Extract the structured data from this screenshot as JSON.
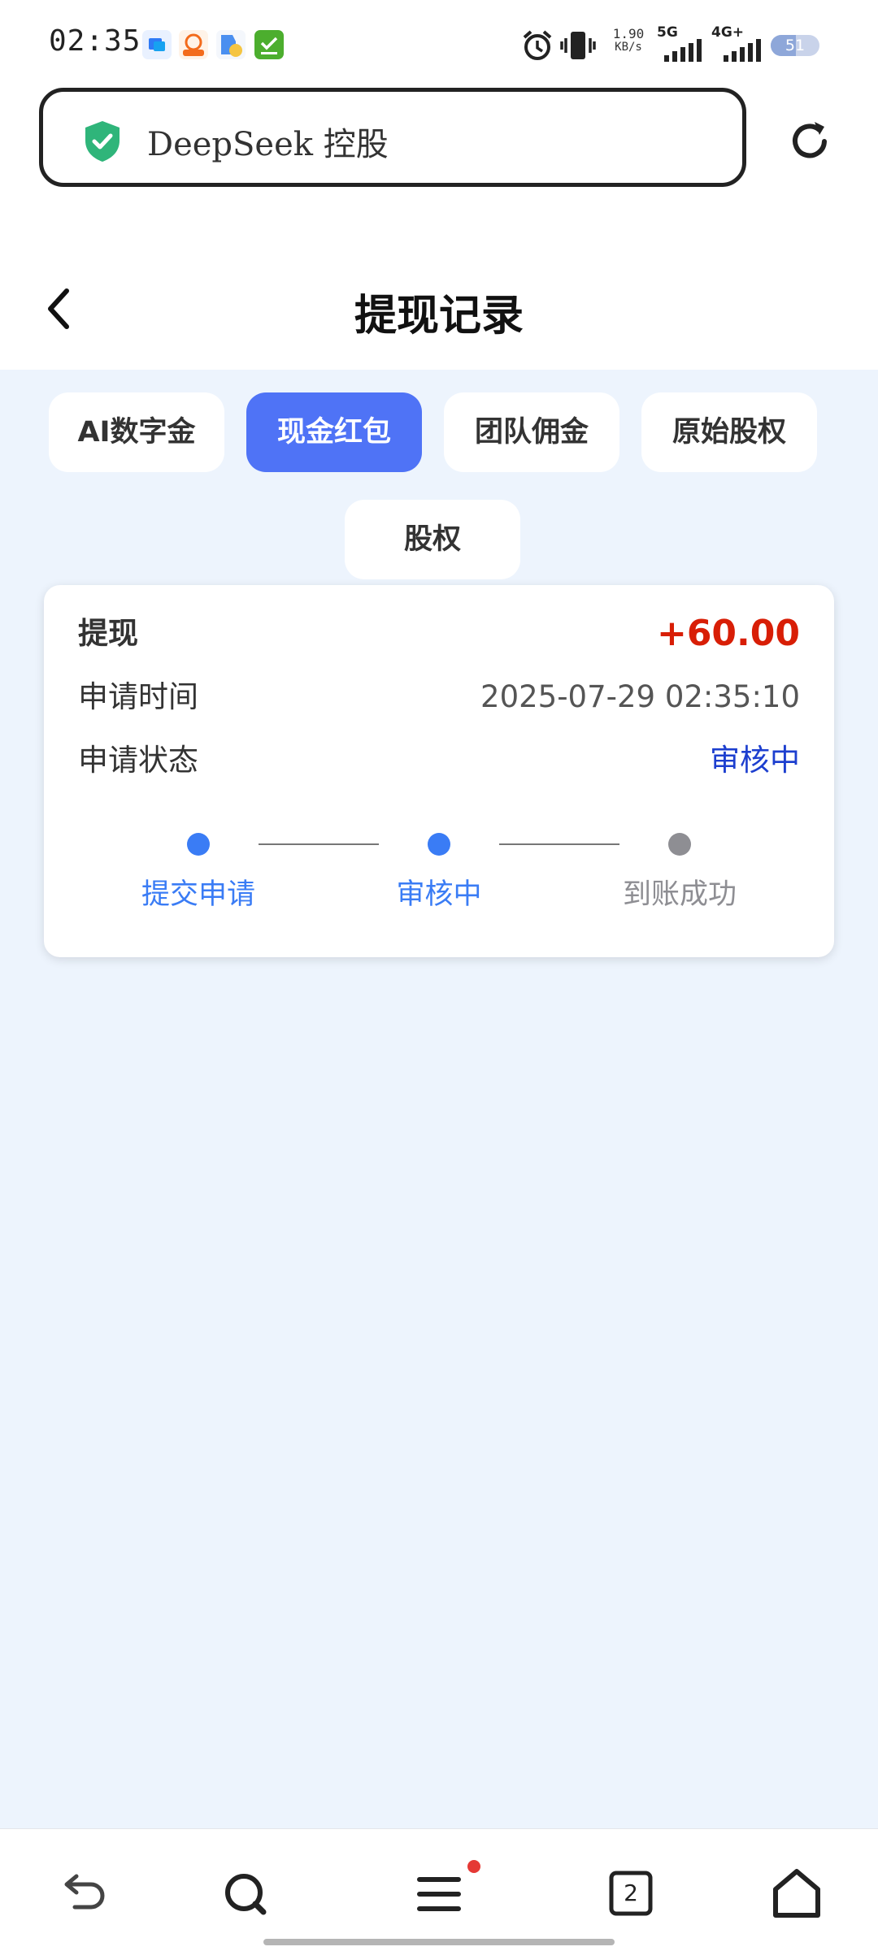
{
  "status_bar": {
    "time": "02:35",
    "speed_value": "1.90",
    "speed_unit": "KB/s",
    "network_1": "5G",
    "network_2": "4G+",
    "battery": "51",
    "battery_fraction": 0.51,
    "notification_icons": [
      "app-icon-blue",
      "app-icon-orange",
      "app-icon-blue-yellow",
      "app-icon-green-check"
    ]
  },
  "browser": {
    "url_text": "DeepSeek 控股",
    "secure_icon": "shield-check-icon",
    "reload_icon": "reload-icon"
  },
  "header": {
    "title": "提现记录",
    "back_icon": "chevron-left-icon"
  },
  "tabs": [
    {
      "label": "AI数字金",
      "active": false
    },
    {
      "label": "现金红包",
      "active": true
    },
    {
      "label": "团队佣金",
      "active": false
    },
    {
      "label": "原始股权",
      "active": false
    },
    {
      "label": "股权",
      "active": false
    }
  ],
  "record": {
    "type_label": "提现",
    "amount": "+60.00",
    "time_label": "申请时间",
    "time_value": "2025-07-29 02:35:10",
    "status_label": "申请状态",
    "status_value": "审核中",
    "steps": [
      {
        "label": "提交申请",
        "done": true
      },
      {
        "label": "审核中",
        "done": true
      },
      {
        "label": "到账成功",
        "done": false
      }
    ]
  },
  "bottom_nav": {
    "tab_count": "2",
    "icons": [
      "back-arrow-icon",
      "search-icon",
      "menu-icon",
      "tabs-icon",
      "home-icon"
    ]
  },
  "colors": {
    "accent": "#4f73f6",
    "step_active": "#3a7cf5",
    "step_inactive": "#8e8e93",
    "amount": "#d81e06",
    "status": "#1d3fcf",
    "page_bg": "#edf4fd"
  }
}
